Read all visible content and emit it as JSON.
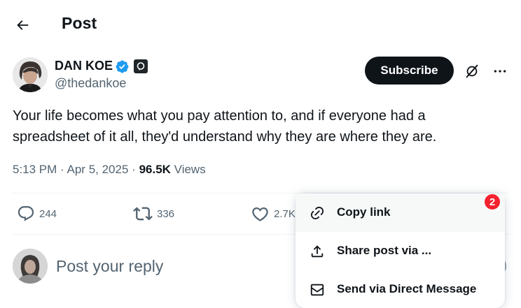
{
  "header": {
    "title": "Post"
  },
  "author": {
    "name": "DAN KOE",
    "handle": "@thedankoe"
  },
  "buttons": {
    "subscribe": "Subscribe"
  },
  "post": {
    "text": "Your life becomes what you pay attention to, and if everyone had a spreadsheet of it all, they'd understand why they are where they are.",
    "time": "5:13 PM",
    "date": "Apr 5, 2025",
    "views_count": "96.5K",
    "views_label": "Views",
    "separator": "·"
  },
  "actions": {
    "replies": "244",
    "reposts": "336",
    "likes": "2.7K"
  },
  "reply": {
    "placeholder": "Post your reply"
  },
  "share_menu": {
    "badge": "2",
    "items": [
      {
        "label": "Copy link",
        "icon": "link-icon"
      },
      {
        "label": "Share post via ...",
        "icon": "share-icon"
      },
      {
        "label": "Send via Direct Message",
        "icon": "envelope-icon"
      }
    ]
  },
  "colors": {
    "text": "#0f1419",
    "secondary": "#536471",
    "verified": "#1d9bf0",
    "badge": "#f4212e"
  }
}
